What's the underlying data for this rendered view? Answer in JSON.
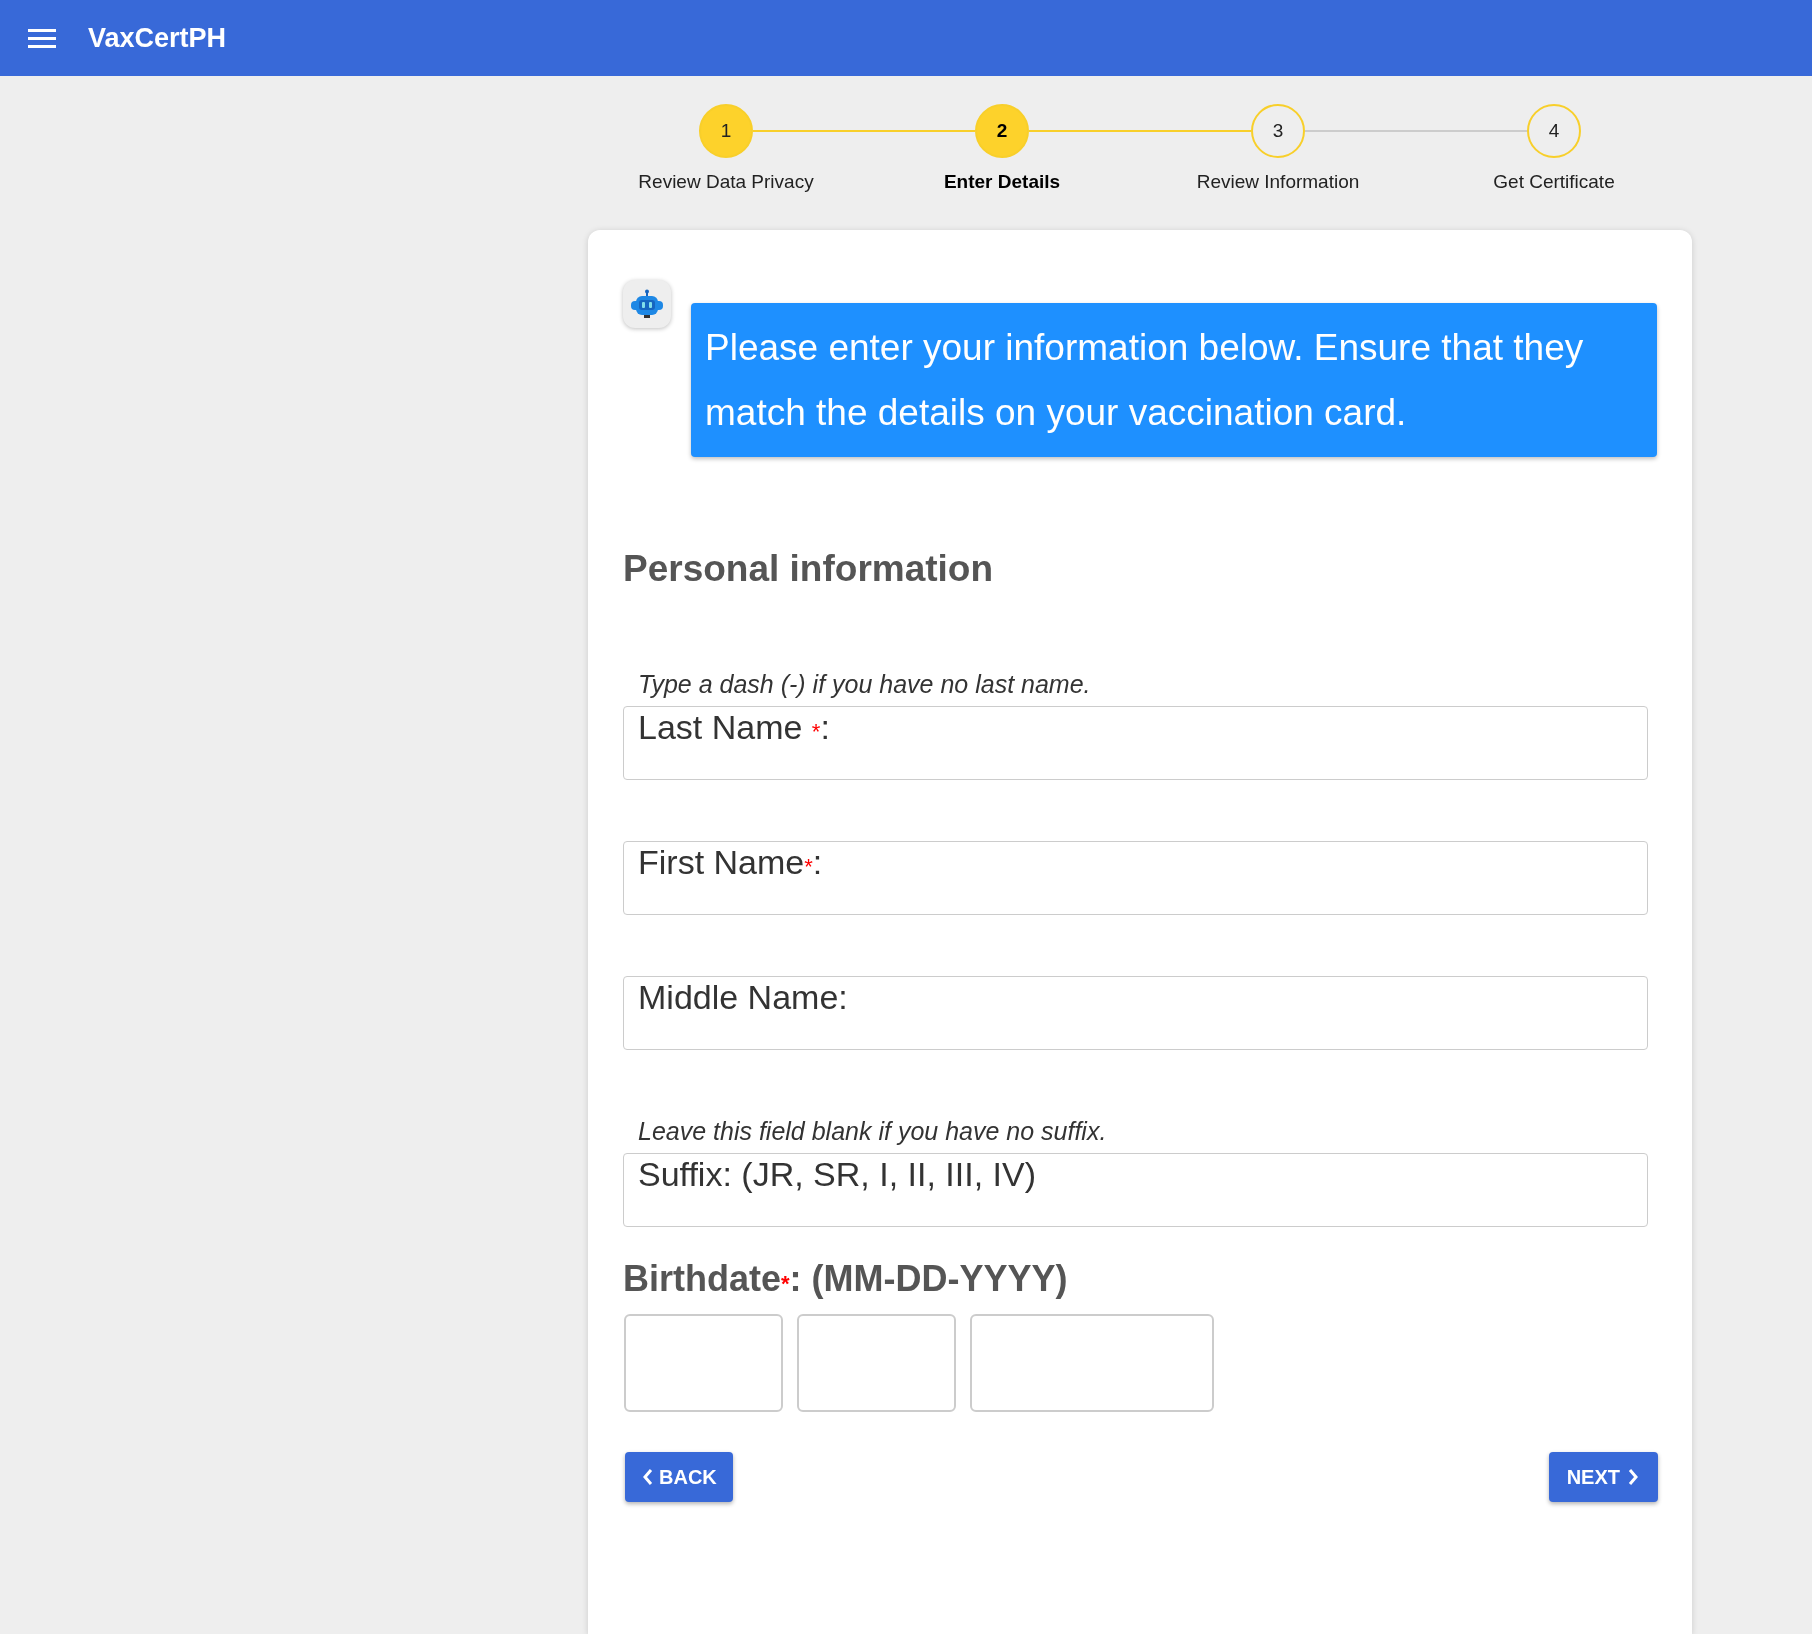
{
  "app_bar": {
    "title": "VaxCertPH"
  },
  "steps": [
    {
      "number": "1",
      "label": "Review Data Privacy",
      "completed": true,
      "selected": false
    },
    {
      "number": "2",
      "label": "Enter Details",
      "completed": false,
      "selected": true
    },
    {
      "number": "3",
      "label": "Review Information",
      "completed": false,
      "selected": false
    },
    {
      "number": "4",
      "label": "Get Certificate",
      "completed": false,
      "selected": false
    }
  ],
  "message": "Please enter your information below. Ensure that they match the details on your vaccination card.",
  "section_title": "Personal information",
  "fields": [
    {
      "hint": "Type a dash (-) if you have no last name.",
      "label": "Last Name ",
      "mark": "*",
      "after": ":"
    },
    {
      "label": "First Name",
      "mark": "*",
      "after": ":"
    },
    {
      "label": "Middle Name:"
    },
    {
      "hint": "Leave this field blank if you have no suffix.",
      "label": "Suffix: (JR, SR, I, II, III, IV)"
    }
  ],
  "birthdate": {
    "label": "Birthdate",
    "mark": "*",
    "after": ": (MM-DD-YYYY)",
    "boxes": [
      {
        "kind": "short"
      },
      {
        "kind": "short"
      },
      {
        "kind": "long"
      }
    ]
  },
  "buttons": {
    "back": "BACK",
    "next": "NEXT"
  }
}
